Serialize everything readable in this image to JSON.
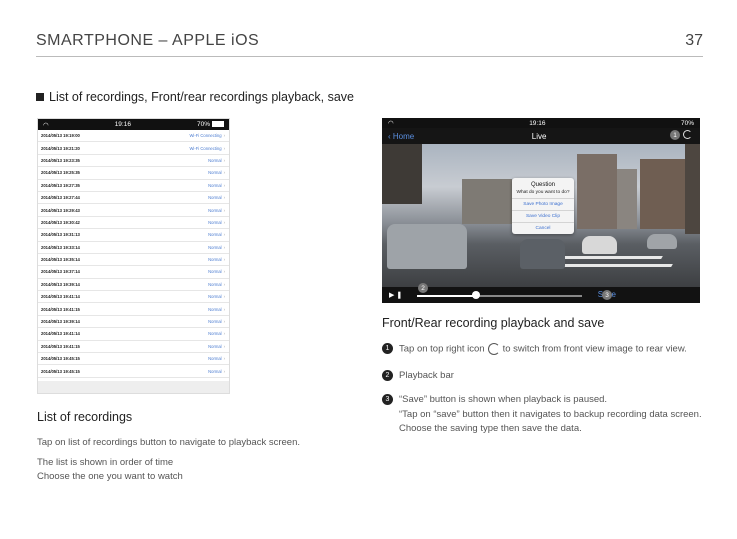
{
  "header": {
    "title": "SMARTPHONE – APPLE iOS",
    "page": "37"
  },
  "section_title": "List of recordings, Front/rear recordings playback, save",
  "list_phone": {
    "status": {
      "time": "19:16",
      "battery": "70%"
    },
    "rows": [
      {
        "dt": "2014/05/13 19:19:00",
        "status": "Wi-Fi Connecting"
      },
      {
        "dt": "2014/05/13 19:21:20",
        "status": "Wi-Fi Connecting"
      },
      {
        "dt": "2014/05/13 19:23:35",
        "status": "Normal"
      },
      {
        "dt": "2014/05/13 19:25:35",
        "status": "Normal"
      },
      {
        "dt": "2014/05/13 19:27:35",
        "status": "Normal"
      },
      {
        "dt": "2014/05/13 19:27:44",
        "status": "Normal"
      },
      {
        "dt": "2014/05/13 19:29:43",
        "status": "Normal"
      },
      {
        "dt": "2014/05/13 19:30:42",
        "status": "Normal"
      },
      {
        "dt": "2014/05/13 19:31:13",
        "status": "Normal"
      },
      {
        "dt": "2014/05/13 19:33:14",
        "status": "Normal"
      },
      {
        "dt": "2014/05/13 19:35:14",
        "status": "Normal"
      },
      {
        "dt": "2014/05/13 19:37:14",
        "status": "Normal"
      },
      {
        "dt": "2014/05/13 19:39:14",
        "status": "Normal"
      },
      {
        "dt": "2014/05/13 19:41:14",
        "status": "Normal"
      },
      {
        "dt": "2014/05/13 19:41:15",
        "status": "Normal"
      },
      {
        "dt": "2014/05/13 19:39:14",
        "status": "Normal"
      },
      {
        "dt": "2014/05/13 19:41:14",
        "status": "Normal"
      },
      {
        "dt": "2014/05/13 19:41:15",
        "status": "Normal"
      },
      {
        "dt": "2014/05/13 19:45:15",
        "status": "Normal"
      },
      {
        "dt": "2014/05/13 19:45:15",
        "status": "Normal"
      },
      {
        "dt": "2014/05/13 20:11:24",
        "status": "Normal"
      },
      {
        "dt": "2014/05/13 20:11:57",
        "status": "Wi-Fi Connected"
      }
    ]
  },
  "list_caption": {
    "title": "List of recordings",
    "line1": "Tap on list of recordings button to navigate to playback screen.",
    "line2": "The list is shown in order of time",
    "line3": "Choose the one you want to watch"
  },
  "video_phone": {
    "status": {
      "time": "19:16",
      "battery": "70%"
    },
    "nav_back": "Home",
    "nav_title": "Live",
    "dialog": {
      "title": "Question",
      "message": "What do you want to do?",
      "btn1": "Save Photo Image",
      "btn2": "Save Video Clip",
      "btn3": "Cancel"
    },
    "progress": 0.36,
    "save_label": "Save",
    "badges": [
      "1",
      "2",
      "3"
    ]
  },
  "playback": {
    "title": "Front/Rear recording playback and save",
    "step1_num": "1",
    "step1_a": "Tap on top right icon",
    "step1_b": "to switch from front view image to rear view.",
    "step2_num": "2",
    "step2": "Playback bar",
    "step3_num": "3",
    "step3_a": "“Save” button is shown when playback is paused.",
    "step3_b": "“Tap on “save” button then it navigates to backup recording data screen.",
    "step3_c": "Choose the saving type then save the data."
  }
}
